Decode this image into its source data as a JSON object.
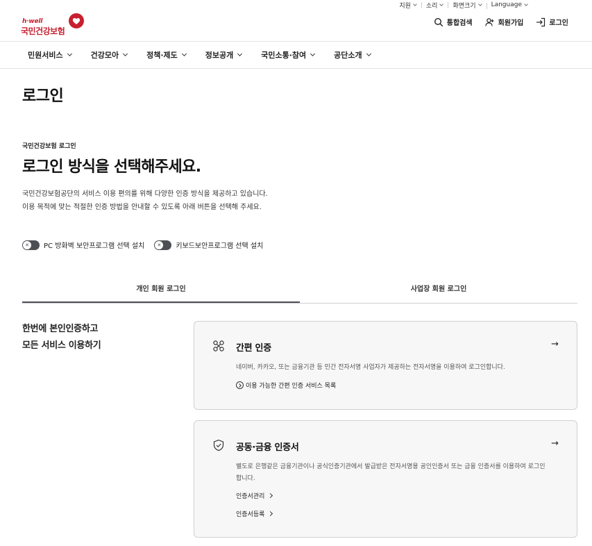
{
  "utility": {
    "items": [
      "지원",
      "소리",
      "화면크기",
      "Language"
    ]
  },
  "logo": {
    "en": "h·well",
    "ko": "국민건강보험"
  },
  "header_actions": {
    "search": "통합검색",
    "signup": "회원가입",
    "login": "로그인"
  },
  "gnb": {
    "items": [
      "민원서비스",
      "건강모아",
      "정책·제도",
      "정보공개",
      "국민소통·참여",
      "공단소개"
    ]
  },
  "page_title": "로그인",
  "intro": {
    "sub_label": "국민건강보험 로그인",
    "heading": "로그인 방식을 선택해주세요.",
    "desc_line1": "국민건강보험공단의 서비스 이용 편의를 위해 다양한 인증 방식을 제공하고 있습니다.",
    "desc_line2": "이용 목적에 맞는 적절한 인증 방법을 안내할 수 있도록 아래 버튼을 선택해 주세요."
  },
  "toggles": {
    "firewall": "PC 방화벽 보안프로그램 선택 설치",
    "keyboard": "키보드보안프로그램 선택 설치",
    "knob_symbol": "✕"
  },
  "tabs": {
    "personal": "개인 회원 로그인",
    "business": "사업장 회원 로그인"
  },
  "left_copy": {
    "line1": "한번에 본인인증하고",
    "line2": "모든 서비스 이용하기"
  },
  "cards": {
    "simple": {
      "title": "간편 인증",
      "arrow": "→",
      "desc": "네이버, 카카오, 또는 금융기관 등 민간 전자서명 사업자가 제공하는 전자서명을 이용하여 로그인합니다.",
      "link": "이용 가능한 간편 인증 서비스 목록"
    },
    "cert": {
      "title": "공동·금융 인증서",
      "arrow": "→",
      "desc": "별도로 은행같은 금융기관이나 공식인증기관에서 발급받은 전자서명용 공인인증서 또는 금융 인증서를 이용하여 로그인합니다.",
      "link1": "인증서관리",
      "link2": "인증서등록"
    }
  },
  "colors": {
    "brand_red": "#c8202f",
    "toggle_dark": "#4e4e55"
  }
}
